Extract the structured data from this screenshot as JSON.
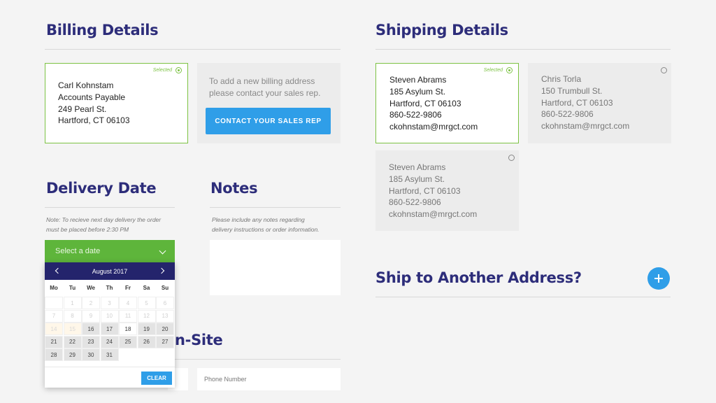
{
  "billing": {
    "title": "Billing Details",
    "selected_label": "Selected",
    "address_lines": [
      "Carl Kohnstam",
      "Accounts Payable",
      "249 Pearl St.",
      "Hartford, CT 06103"
    ],
    "info_lines": [
      "To add a new billing address",
      "please contact your sales rep."
    ],
    "contact_button": "CONTACT YOUR SALES REP"
  },
  "shipping": {
    "title": "Shipping Details",
    "selected_label": "Selected",
    "addresses": [
      {
        "lines": [
          "Steven Abrams",
          "185 Asylum St.",
          "Hartford, CT 06103",
          "860-522-9806",
          "ckohnstam@mrgct.com"
        ],
        "selected": true
      },
      {
        "lines": [
          "Chris Torla",
          "150 Trumbull St.",
          "Hartford, CT 06103",
          "860-522-9806",
          "ckohnstam@mrgct.com"
        ],
        "selected": false
      },
      {
        "lines": [
          "Steven Abrams",
          "185 Asylum St.",
          "Hartford, CT 06103",
          "860-522-9806",
          "ckohnstam@mrgct.com"
        ],
        "selected": false
      }
    ],
    "another_title": "Ship to Another Address?"
  },
  "delivery": {
    "title": "Delivery Date",
    "note_lines": [
      "Note: To recieve next day delivery the order",
      "must be placed before 2:30 PM"
    ],
    "select_placeholder": "Select a date",
    "calendar": {
      "month": "August 2017",
      "weekdays": [
        "Mo",
        "Tu",
        "We",
        "Th",
        "Fr",
        "Sa",
        "Su"
      ],
      "weeks": [
        [
          "",
          "1",
          "2",
          "3",
          "4",
          "5",
          "6"
        ],
        [
          "7",
          "8",
          "9",
          "10",
          "11",
          "12",
          "13"
        ],
        [
          "14",
          "15",
          "16",
          "17",
          "18",
          "19",
          "20"
        ],
        [
          "21",
          "22",
          "23",
          "24",
          "25",
          "26",
          "27"
        ],
        [
          "28",
          "29",
          "30",
          "31",
          "",
          "",
          ""
        ]
      ],
      "clear_label": "CLEAR"
    }
  },
  "notes": {
    "title": "Notes",
    "hint_lines": [
      "Please include any notes regarding",
      "delivery instructions or order information."
    ]
  },
  "onsite": {
    "title_partial": "n-Site",
    "phone_placeholder": "Phone Number"
  }
}
